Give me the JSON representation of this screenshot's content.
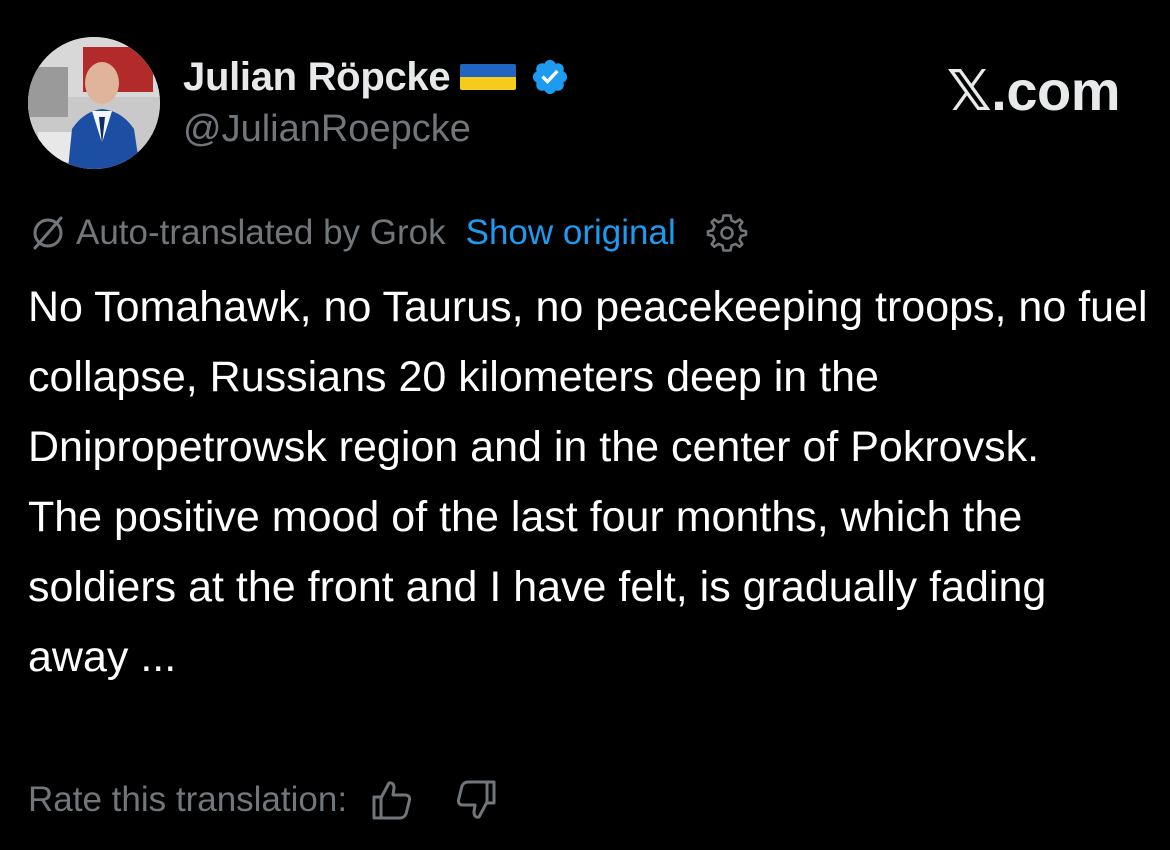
{
  "author": {
    "display_name": "Julian Röpcke",
    "handle": "@JulianRoepcke",
    "flag_icon": "ukraine-flag-icon",
    "verified_icon": "verified-badge-icon"
  },
  "brand": {
    "label": "𝕏.com"
  },
  "translation": {
    "icon": "no-translate-icon",
    "label": "Auto-translated by Grok",
    "show_original": "Show original",
    "settings_icon": "gear-icon"
  },
  "tweet": {
    "paragraphs": [
      "No Tomahawk, no Taurus, no peacekeeping troops, no fuel collapse, Russians 20 kilometers deep in the Dnipropetrowsk region and in the center of Pokrovsk.",
      "The positive mood of the last four months, which the soldiers at the front and I have felt, is gradually fading away ..."
    ]
  },
  "rating": {
    "label": "Rate this translation:",
    "thumbs_up_icon": "thumbs-up-icon",
    "thumbs_down_icon": "thumbs-down-icon"
  },
  "colors": {
    "background": "#000000",
    "primary_text": "#e7e9ea",
    "secondary_text": "#71767b",
    "link": "#1d9bf0",
    "verified": "#1d9bf0",
    "flag_blue": "#1f66c2",
    "flag_yellow": "#f5cc1c"
  }
}
